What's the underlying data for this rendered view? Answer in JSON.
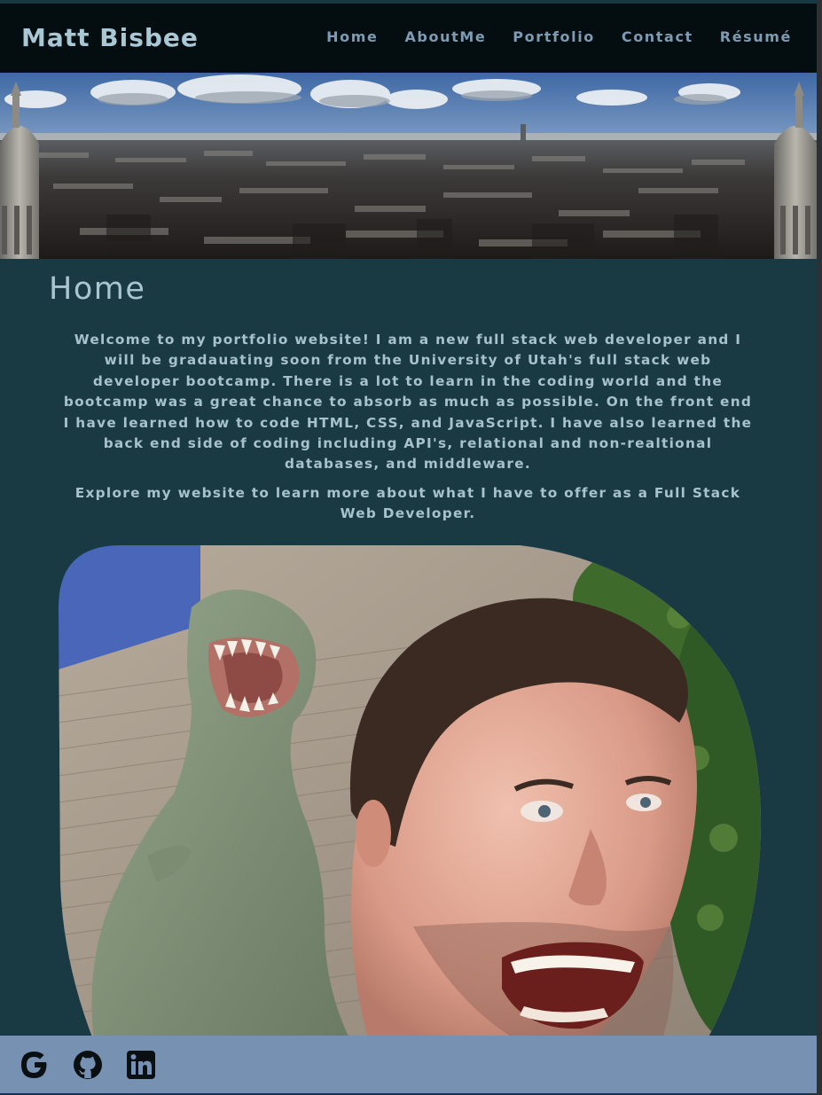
{
  "header": {
    "brand": "Matt Bisbee",
    "nav": [
      {
        "label": "Home"
      },
      {
        "label": "AboutMe"
      },
      {
        "label": "Portfolio"
      },
      {
        "label": "Contact"
      },
      {
        "label": "Résumé"
      }
    ]
  },
  "main": {
    "title": "Home",
    "intro": "Welcome to my portfolio website! I am a new full stack web developer and I will be gradauating soon from the University of Utah's full stack web developer bootcamp. There is a lot to learn in the coding world and the bootcamp was a great chance to absorb as much as possible. On the front end I have learned how to code HTML, CSS, and JavaScript. I have also learned the back end side of coding including API's, relational and non-realtional databases, and middleware.",
    "explore": "Explore my website to learn more about what I have to offer as a Full Stack Web Developer."
  },
  "footer": {
    "social": [
      {
        "icon": "google-icon"
      },
      {
        "icon": "github-icon"
      },
      {
        "icon": "linkedin-icon"
      }
    ]
  },
  "colors": {
    "header_bg": "#040e10",
    "page_bg": "#193a42",
    "footer_bg": "#7791b2",
    "brand_text": "#a9c7d4",
    "nav_text": "#7d9bb3",
    "body_text": "#a7c1cd"
  }
}
